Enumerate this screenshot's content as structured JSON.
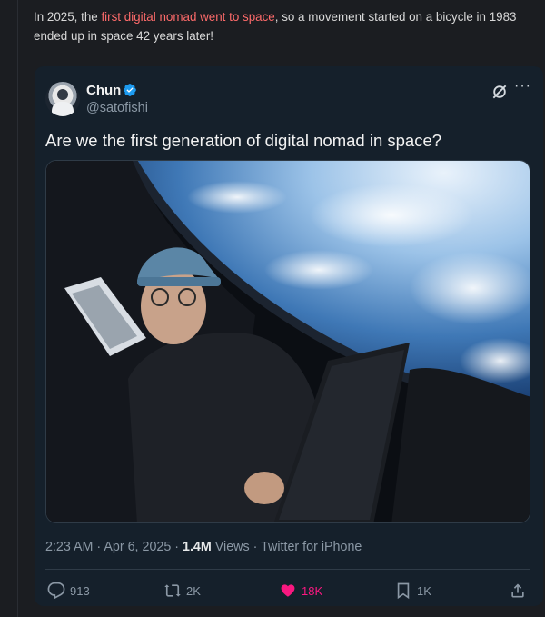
{
  "intro": {
    "prefix": "In 2025, the ",
    "link": "first digital nomad went to space",
    "suffix": ", so a movement started on a bicycle in 1983 ended up in space 42 years later!"
  },
  "tweet": {
    "author_name": "Chun",
    "author_handle": "@satofishi",
    "text": "Are we the first generation of digital nomad in space?",
    "timestamp": "2:23 AM · Apr 6, 2025 · ",
    "views_count": "1.4M",
    "views_label": " Views · Twitter for iPhone",
    "replies": "913",
    "retweets": "2K",
    "likes": "18K",
    "bookmarks": "1K"
  },
  "icons": {
    "verified": "verified-badge-icon",
    "x_logo": "x-logo-icon",
    "more": "more-options-icon",
    "reply": "reply-icon",
    "retweet": "retweet-icon",
    "like": "heart-icon",
    "bookmark": "bookmark-icon",
    "share": "share-icon"
  },
  "colors": {
    "link": "#ff6b6b",
    "verified": "#1d9bf0",
    "like": "#f91880",
    "card_bg": "#15202b"
  }
}
